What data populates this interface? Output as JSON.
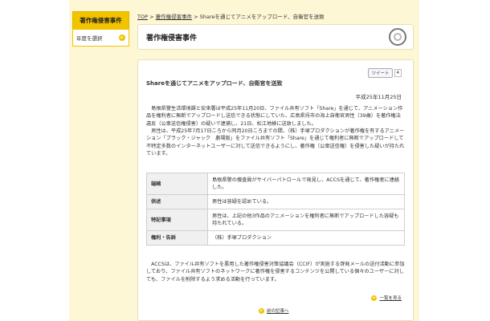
{
  "sidebar": {
    "heading": "著作権侵害事件",
    "item_label": "年度を選択",
    "item_arrow": "▸"
  },
  "breadcrumb": {
    "items": [
      "TOP",
      "著作権侵害事件"
    ],
    "sep": ">",
    "current": "Shareを通じてアニメをアップロード、自衛官を送致"
  },
  "page_title": "著作権侵害事件",
  "tweet": {
    "label": "ツイート",
    "count": "4"
  },
  "article": {
    "title": "Shareを通じてアニメをアップロード、自衛官を送致",
    "date": "平成25年11月25日",
    "p1": "　島根県警生活環境課と安来署は平成25年11月20日、ファイル共有ソフト「Share」を通じて、アニメーション作品を権利者に無断でアップロードし送信できる状態にしていた、広島県呉市の海上自衛官男性（39歳）を著作権法違反（公衆送信権侵害）の疑いで逮捕し、21日、松江地検に送致しました。",
    "p2": "　男性は、平成25年7月17日ころから同月20日ころまでの間、（株）手塚プロダクションが著作権を有するアニメーション「ブラック・ジャック　劇場版」をファイル共有ソフト「Share」を通じて権利者に無断でアップロードして不特定多数のインターネットユーザーに対して送信できるようにし、著作権（公衆送信権）を侵害した疑いが持たれています。",
    "p3": "　ACCSは、ファイル共有ソフトを悪用した著作権侵害対策協議会（CCIF）が実施する啓発メールの送付活動に参加しており、ファイル共有ソフトのネットワークに著作権を侵害するコンテンツを公開している個々のユーザーに対しても、ファイルを削除するよう求める活動を行っています。"
  },
  "info_table": [
    {
      "key": "端緒",
      "value": "島根県警の捜査員がサイバーパトロールで発見し、ACCSを通じて、著作権者に連絡した。"
    },
    {
      "key": "供述",
      "value": "男性は容疑を認めている。"
    },
    {
      "key": "特記事項",
      "value": "男性は、上記の他3作品のアニメーションを権利者に無断でアップロードした容疑も持たれている。"
    },
    {
      "key": "権利・告訴",
      "value": "（株）手塚プロダクション"
    }
  ],
  "links": {
    "list_label": "一覧を見る",
    "prev_label": "前の記事へ",
    "arrow": "▸"
  }
}
